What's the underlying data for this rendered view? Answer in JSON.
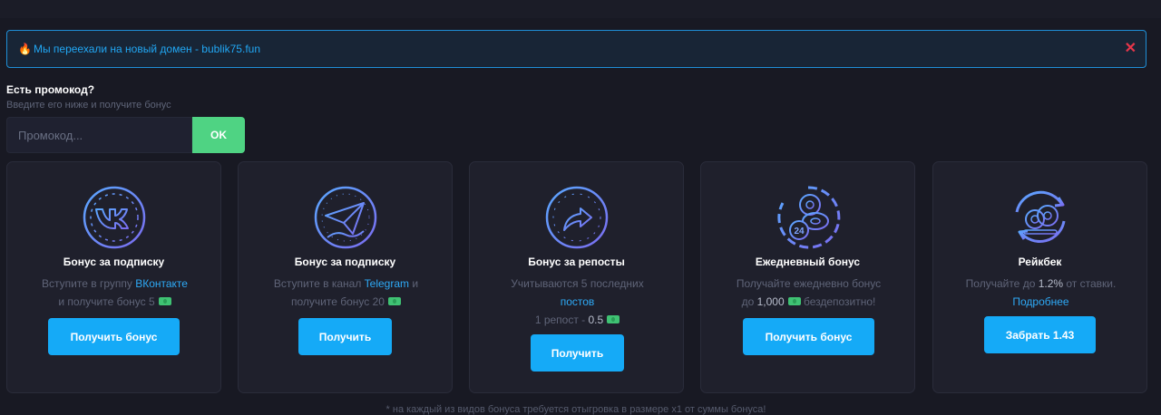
{
  "notice": {
    "flame": "🔥",
    "text": "Мы переехали на новый домен - bublik75.fun",
    "close": "✕"
  },
  "promo": {
    "title": "Есть промокод?",
    "subtitle": "Введите его ниже и получите бонус",
    "placeholder": "Промокод...",
    "button": "OK"
  },
  "cards": [
    {
      "icon": "vk-icon",
      "title": "Бонус за подписку",
      "line1_pre": "Вступите в группу ",
      "line1_link": "ВКонтакте",
      "line2": "и получите бонус 5",
      "button": "Получить бонус"
    },
    {
      "icon": "telegram-icon",
      "title": "Бонус за подписку",
      "line1_pre": "Вступите в канал ",
      "line1_link": "Telegram",
      "line1_post": " и",
      "line2": "получите бонус 20",
      "button": "Получить"
    },
    {
      "icon": "repost-icon",
      "title": "Бонус за репосты",
      "line1": "Учитываются 5 последних",
      "line2_link": "постов",
      "line3_pre": "1 репост - ",
      "line3_value": "0.5",
      "button": "Получить"
    },
    {
      "icon": "daily-24h-icon",
      "title": "Ежедневный бонус",
      "line1": "Получайте ежедневно бонус",
      "line2_pre": "до ",
      "line2_value": "1,000",
      "line2_post": " бездепозитно!",
      "button": "Получить бонус"
    },
    {
      "icon": "rakeback-icon",
      "title": "Рейкбек",
      "line1_pre": "Получайте до ",
      "line1_value": "1.2%",
      "line1_post": " от ставки.",
      "line2_link": "Подробнее",
      "button": "Забрать 1.43"
    }
  ],
  "footnote": "* на каждый из видов бонуса требуется отыгровка в размере x1 от суммы бонуса!",
  "colors": {
    "background": "#181923",
    "card": "#1f202c",
    "accent": "#15aaf7",
    "ok_button": "#4fd383",
    "notice_border": "#1f8ed6",
    "close": "#e8364a"
  }
}
